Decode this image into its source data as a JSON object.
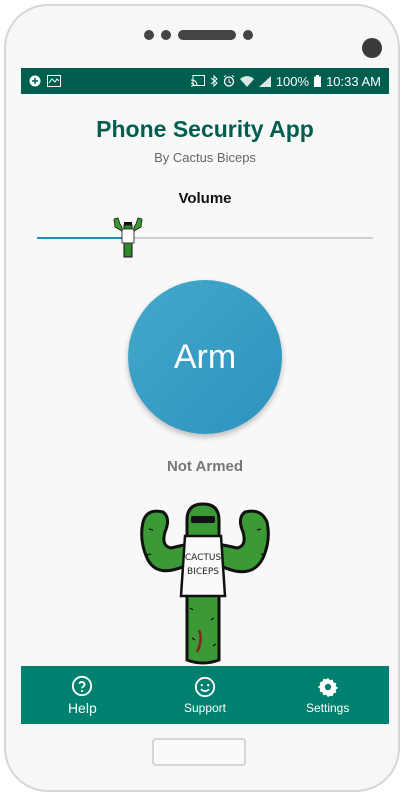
{
  "status_bar": {
    "battery": "100%",
    "time": "10:33 AM",
    "left_icons": [
      "app-notification-icon",
      "activity-icon"
    ],
    "right_icons": [
      "cast-icon",
      "bluetooth-icon",
      "alarm-icon",
      "wifi-icon",
      "signal-icon",
      "battery-icon"
    ]
  },
  "header": {
    "title": "Phone Security App",
    "subtitle": "By Cactus Biceps"
  },
  "volume": {
    "label": "Volume",
    "level_percent": 27
  },
  "arm_button": {
    "label": "Arm"
  },
  "arm_status": "Not Armed",
  "mascot": {
    "shirt_text": "CACTUS BICEPS"
  },
  "bottom_nav": [
    {
      "label": "Help",
      "icon": "help-icon"
    },
    {
      "label": "Support",
      "icon": "smiley-icon"
    },
    {
      "label": "Settings",
      "icon": "gear-icon"
    }
  ],
  "colors": {
    "brand_dark": "#005e4f",
    "nav_bg": "#00806f",
    "arm_blue": "#3aa0c6",
    "slider_accent": "#1e8fb4"
  }
}
